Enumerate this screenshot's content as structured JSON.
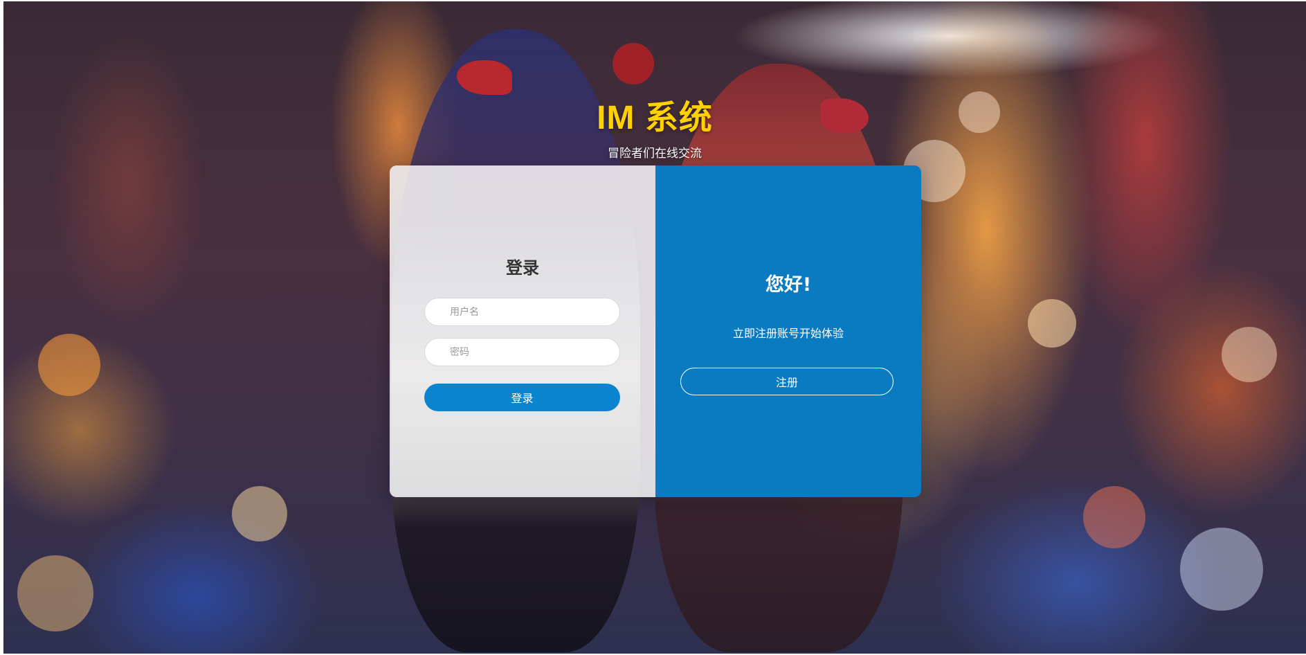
{
  "header": {
    "title": "IM 系统",
    "subtitle": "冒险者们在线交流"
  },
  "login": {
    "title": "登录",
    "username_placeholder": "用户名",
    "password_placeholder": "密码",
    "username_value": "",
    "password_value": "",
    "submit_label": "登录"
  },
  "register": {
    "title": "您好!",
    "text": "立即注册账号开始体验",
    "button_label": "注册"
  },
  "colors": {
    "title": "#ffd100",
    "primary": "#0a84cf",
    "register_panel": "#0b7bc1",
    "login_panel": "#eeeef0"
  }
}
